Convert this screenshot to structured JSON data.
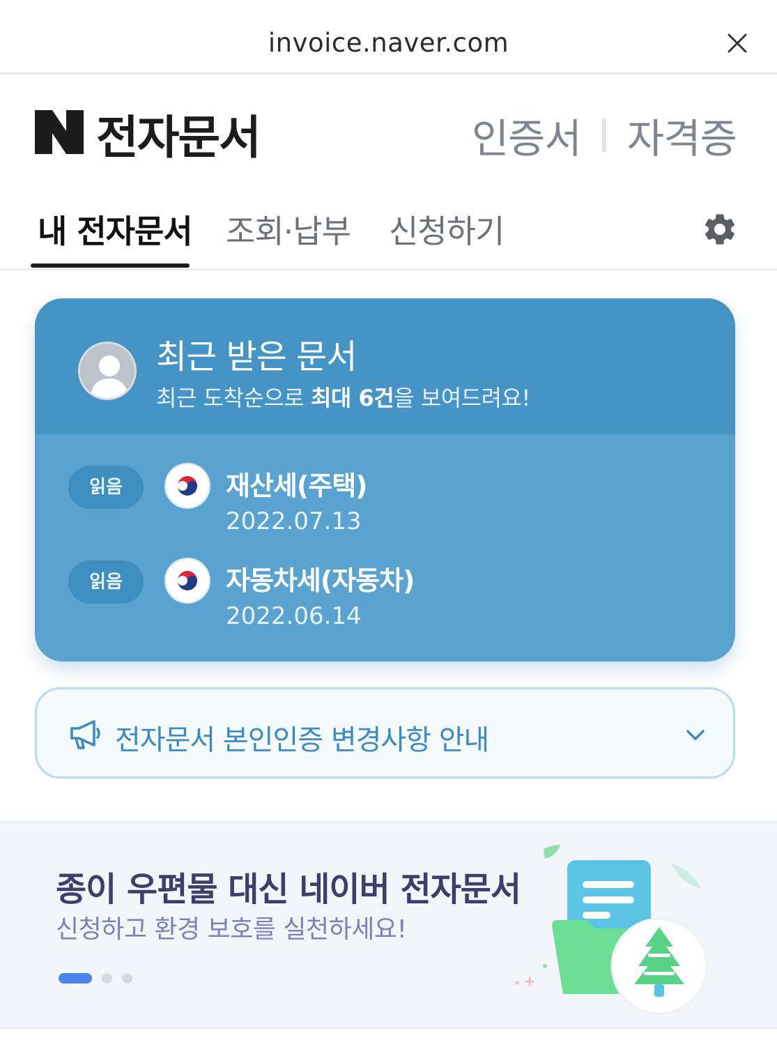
{
  "browser": {
    "url": "invoice.naver.com"
  },
  "header": {
    "brand": "전자문서",
    "links": [
      "인증서",
      "자격증"
    ]
  },
  "tabs": [
    {
      "label": "내 전자문서",
      "active": true
    },
    {
      "label": "조회·납부",
      "active": false
    },
    {
      "label": "신청하기",
      "active": false
    }
  ],
  "recent": {
    "title": "최근 받은 문서",
    "subtitle_pre": "최근 도착순으로 ",
    "subtitle_bold": "최대 6건",
    "subtitle_post": "을 보여드려요!",
    "documents": [
      {
        "status": "읽음",
        "title": "재산세(주택)",
        "date": "2022.07.13"
      },
      {
        "status": "읽음",
        "title": "자동차세(자동차)",
        "date": "2022.06.14"
      }
    ]
  },
  "notice": {
    "text": "전자문서 본인인증 변경사항 안내"
  },
  "banner": {
    "title": "종이 우편물 대신 네이버 전자문서",
    "subtitle": "신청하고 환경 보호를 실천하세요!",
    "page_count": 3,
    "active_page": 1
  },
  "colors": {
    "card_top": "#4693c5",
    "card_body": "#5aa3d0",
    "notice_text": "#3b8bc2",
    "banner_title": "#3b3f6a",
    "banner_sub": "#7a83b8",
    "dot_active": "#4a86e8"
  },
  "icons": {
    "close": "close-icon",
    "settings": "gear-icon",
    "notice": "megaphone-icon",
    "expand": "chevron-down-icon"
  }
}
